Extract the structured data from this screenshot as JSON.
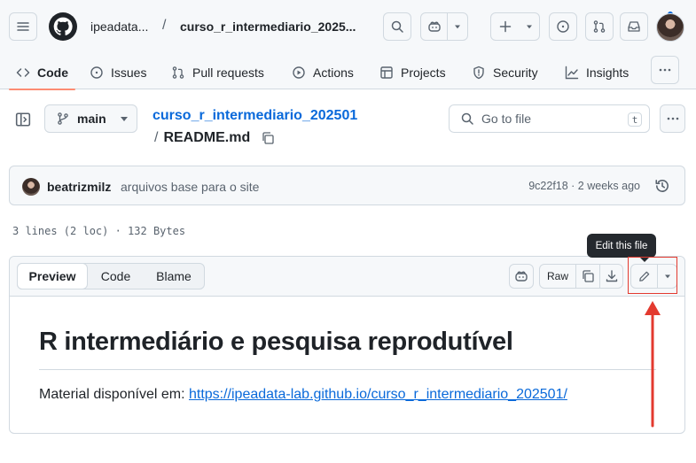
{
  "header": {
    "owner": "ipeadata...",
    "separator": "/",
    "repo": "curso_r_intermediario_2025..."
  },
  "tabs": [
    {
      "label": "Code",
      "icon": "code-icon",
      "active": true
    },
    {
      "label": "Issues",
      "icon": "issue-opened-icon"
    },
    {
      "label": "Pull requests",
      "icon": "git-pull-request-icon"
    },
    {
      "label": "Actions",
      "icon": "play-icon"
    },
    {
      "label": "Projects",
      "icon": "table-icon"
    },
    {
      "label": "Security",
      "icon": "shield-icon"
    },
    {
      "label": "Insights",
      "icon": "graph-icon"
    }
  ],
  "file_nav": {
    "branch": "main",
    "repo_link": "curso_r_intermediario_202501",
    "path_sep": "/",
    "file_name": "README.md",
    "goto_placeholder": "Go to file",
    "goto_shortcut": "t"
  },
  "commit": {
    "author": "beatrizmilz",
    "message": "arquivos base para o site",
    "meta": "9c22f18 · 2 weeks ago"
  },
  "file_info": "3 lines (2 loc) · 132 Bytes",
  "file_header": {
    "views": [
      "Preview",
      "Code",
      "Blame"
    ],
    "active_view": "Preview",
    "raw_label": "Raw",
    "tooltip": "Edit this file"
  },
  "readme": {
    "heading": "R intermediário e pesquisa reprodutível",
    "text_prefix": "Material disponível em: ",
    "link": "https://ipeadata-lab.github.io/curso_r_intermediario_202501/"
  },
  "colors": {
    "link": "#0969da",
    "active_tab_underline": "#fd8c73",
    "annotation": "#e33a2f",
    "notification_dot": "#0969da"
  }
}
